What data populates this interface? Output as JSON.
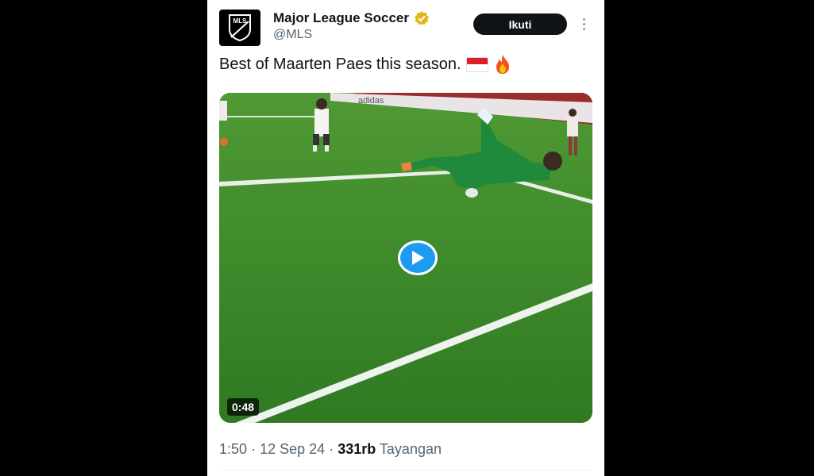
{
  "tweet": {
    "author_name": "Major League Soccer",
    "handle": "@MLS",
    "avatar_text": "MLS",
    "follow_label": "Ikuti",
    "text": "Best of Maarten Paes this season.",
    "emojis": [
      "indonesia-flag-icon",
      "fire-icon"
    ]
  },
  "media": {
    "type": "video",
    "duration": "0:48",
    "banner_text": "adidas"
  },
  "meta": {
    "time": "1:50",
    "sep1": "·",
    "date": "12 Sep 24",
    "sep2": "·",
    "views": "331rb",
    "views_label": "Tayangan"
  },
  "colors": {
    "follow_bg": "#0f1419",
    "verified": "#e2b719",
    "play": "#1d9bf0",
    "pitch": "#3f8a2a",
    "meta_text": "#536471"
  }
}
